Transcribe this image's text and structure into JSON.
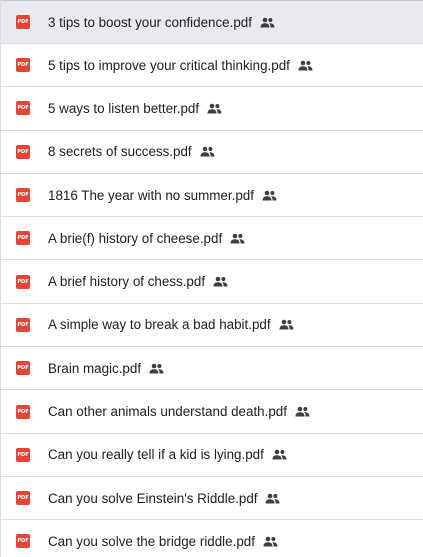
{
  "files": [
    {
      "name": "3 tips to boost your confidence.pdf",
      "icon": "pdf-icon",
      "shared_icon": "shared-people-icon",
      "selected": true
    },
    {
      "name": "5 tips to improve your critical thinking.pdf",
      "icon": "pdf-icon",
      "shared_icon": "shared-people-icon"
    },
    {
      "name": "5 ways to listen better.pdf",
      "icon": "pdf-icon",
      "shared_icon": "shared-people-icon"
    },
    {
      "name": "8 secrets of success.pdf",
      "icon": "pdf-icon",
      "shared_icon": "shared-people-icon"
    },
    {
      "name": "1816 The year with no summer.pdf",
      "icon": "pdf-icon",
      "shared_icon": "shared-people-icon"
    },
    {
      "name": "A brie(f) history of cheese.pdf",
      "icon": "pdf-icon",
      "shared_icon": "shared-people-icon"
    },
    {
      "name": "A brief history of chess.pdf",
      "icon": "pdf-icon",
      "shared_icon": "shared-people-icon"
    },
    {
      "name": "A simple way to break a bad habit.pdf",
      "icon": "pdf-icon",
      "shared_icon": "shared-people-icon"
    },
    {
      "name": "Brain magic.pdf",
      "icon": "pdf-icon",
      "shared_icon": "shared-people-icon"
    },
    {
      "name": "Can other animals understand death.pdf",
      "icon": "pdf-icon",
      "shared_icon": "shared-people-icon"
    },
    {
      "name": "Can you really tell if a kid is lying.pdf",
      "icon": "pdf-icon",
      "shared_icon": "shared-people-icon"
    },
    {
      "name": "Can you solve Einstein's Riddle.pdf",
      "icon": "pdf-icon",
      "shared_icon": "shared-people-icon"
    },
    {
      "name": "Can you solve the bridge riddle.pdf",
      "icon": "pdf-icon",
      "shared_icon": "shared-people-icon"
    }
  ],
  "pdf_badge_text": "PDF",
  "colors": {
    "pdf_red": "#ea4335",
    "text": "#202124",
    "selected_bg": "#e8eaed",
    "divider": "#dadce0"
  }
}
